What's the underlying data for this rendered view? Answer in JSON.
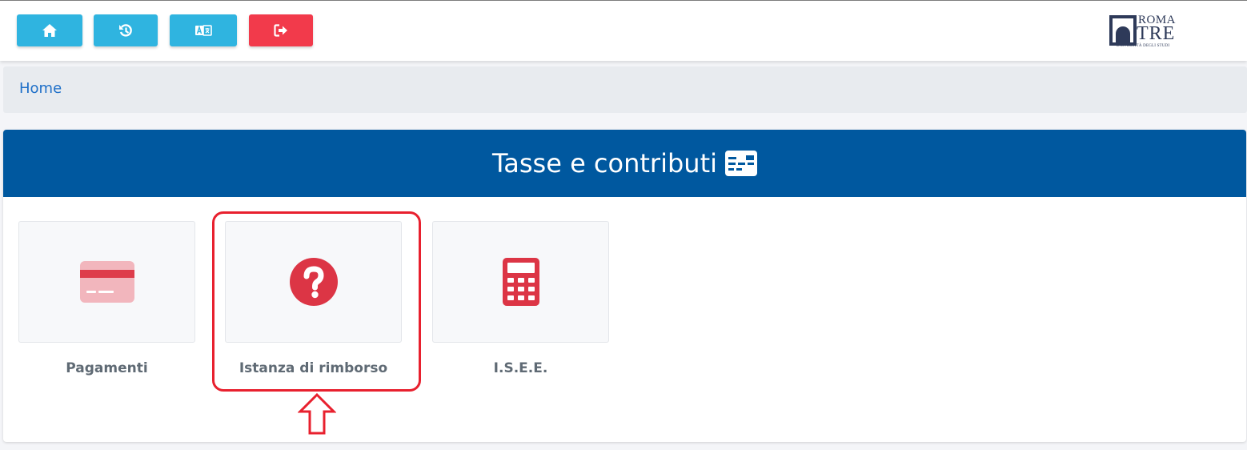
{
  "toolbar": {
    "buttons": [
      {
        "name": "home",
        "icon": "home-icon",
        "color": "#2fb4e0"
      },
      {
        "name": "history",
        "icon": "history-icon",
        "color": "#2fb4e0"
      },
      {
        "name": "language",
        "icon": "translate-icon",
        "color": "#2fb4e0"
      },
      {
        "name": "logout",
        "icon": "sign-out-icon",
        "color": "#f23a4b"
      }
    ]
  },
  "logo": {
    "line1": "ROMA",
    "line2": "TRE",
    "subtitle": "UNIVERSITÀ DEGLI STUDI"
  },
  "breadcrumb": {
    "home": "Home"
  },
  "section": {
    "title": "Tasse e contributi",
    "title_icon": "money-card-icon",
    "header_color": "#00589f"
  },
  "tiles": [
    {
      "label": "Pagamenti",
      "icon": "credit-card-icon"
    },
    {
      "label": "Istanza di rimborso",
      "icon": "question-circle-icon"
    },
    {
      "label": "I.S.E.E.",
      "icon": "calculator-icon"
    }
  ],
  "annotation": {
    "color": "#e8202e",
    "target": "Istanza di rimborso"
  }
}
